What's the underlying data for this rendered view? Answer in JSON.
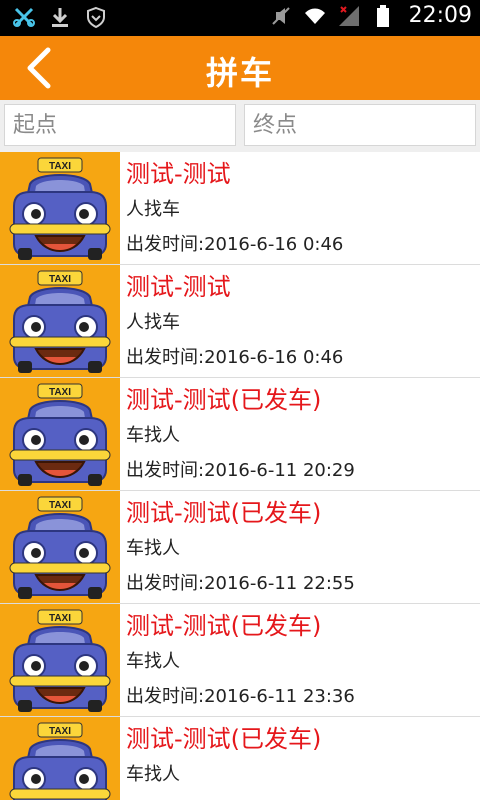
{
  "status_bar": {
    "time": "22:09",
    "left_icons": [
      "usb-debug-icon",
      "download-icon",
      "shield-icon"
    ],
    "right_icons": [
      "silent-icon",
      "wifi-icon",
      "signal-icon",
      "battery-icon"
    ]
  },
  "header": {
    "title": "拼车",
    "back_icon": "chevron-left-icon"
  },
  "search": {
    "start_placeholder": "起点",
    "end_placeholder": "终点"
  },
  "colors": {
    "accent": "#f5870a",
    "route_text": "#e5171b",
    "taxi_yellow": "#fbb01c",
    "taxi_body": "#4a55b7"
  },
  "rides": [
    {
      "route": "测试-测试",
      "kind": "人找车",
      "time": "出发时间:2016-6-16 0:46",
      "icon": "taxi-icon",
      "taxi_label": "TAXI"
    },
    {
      "route": "测试-测试",
      "kind": "人找车",
      "time": "出发时间:2016-6-16 0:46",
      "icon": "taxi-icon",
      "taxi_label": "TAXI"
    },
    {
      "route": "测试-测试(已发车)",
      "kind": "车找人",
      "time": "出发时间:2016-6-11 20:29",
      "icon": "taxi-icon",
      "taxi_label": "TAXI"
    },
    {
      "route": "测试-测试(已发车)",
      "kind": "车找人",
      "time": "出发时间:2016-6-11 22:55",
      "icon": "taxi-icon",
      "taxi_label": "TAXI"
    },
    {
      "route": "测试-测试(已发车)",
      "kind": "车找人",
      "time": "出发时间:2016-6-11 23:36",
      "icon": "taxi-icon",
      "taxi_label": "TAXI"
    },
    {
      "route": "测试-测试(已发车)",
      "kind": "车找人",
      "time": "",
      "icon": "taxi-icon",
      "taxi_label": "TAXI"
    }
  ]
}
